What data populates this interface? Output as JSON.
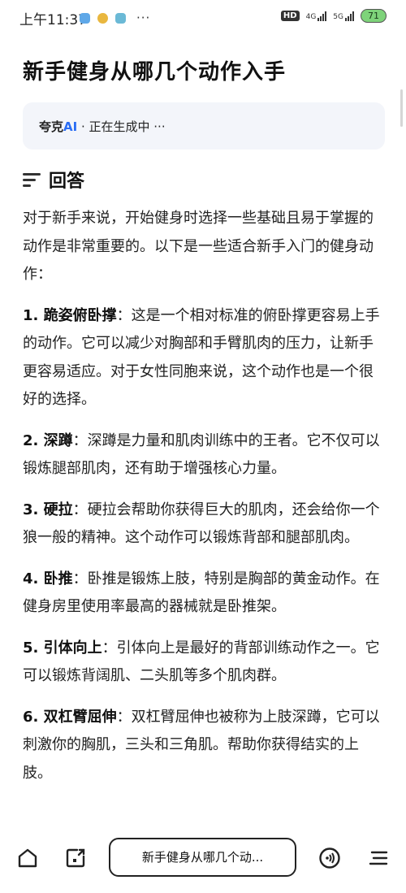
{
  "status_bar": {
    "time": "上午11:37",
    "more": "···",
    "hd": "HD",
    "net1": "4G",
    "net2": "5G",
    "battery": "71"
  },
  "page": {
    "title": "新手健身从哪几个动作入手"
  },
  "generating": {
    "brand": "夸克",
    "ai": "AI",
    "status": " · 正在生成中 ···"
  },
  "answer": {
    "label": "回答",
    "intro": "对于新手来说，开始健身时选择一些基础且易于掌握的动作是非常重要的。以下是一些适合新手入门的健身动作：",
    "items": [
      {
        "num": "1. ",
        "name": "跪姿俯卧撑",
        "desc": "：这是一个相对标准的俯卧撑更容易上手的动作。它可以减少对胸部和手臂肌肉的压力，让新手更容易适应。对于女性同胞来说，这个动作也是一个很好的选择。"
      },
      {
        "num": "2. ",
        "name": "深蹲",
        "desc": "：深蹲是力量和肌肉训练中的王者。它不仅可以锻炼腿部肌肉，还有助于增强核心力量。"
      },
      {
        "num": "3. ",
        "name": "硬拉",
        "desc": "：硬拉会帮助你获得巨大的肌肉，还会给你一个狼一般的精神。这个动作可以锻炼背部和腿部肌肉。"
      },
      {
        "num": "4. ",
        "name": "卧推",
        "desc": "：卧推是锻炼上肢，特别是胸部的黄金动作。在健身房里使用率最高的器械就是卧推架。"
      },
      {
        "num": "5. ",
        "name": "引体向上",
        "desc": "：引体向上是最好的背部训练动作之一。它可以锻炼背阔肌、二头肌等多个肌肉群。"
      },
      {
        "num": "6. ",
        "name": "双杠臂屈伸",
        "desc": "：双杠臂屈伸也被称为上肢深蹲，它可以刺激你的胸肌，三头和三角肌。帮助你获得结实的上肢。"
      }
    ]
  },
  "bottom_bar": {
    "address": "新手健身从哪几个动..."
  }
}
